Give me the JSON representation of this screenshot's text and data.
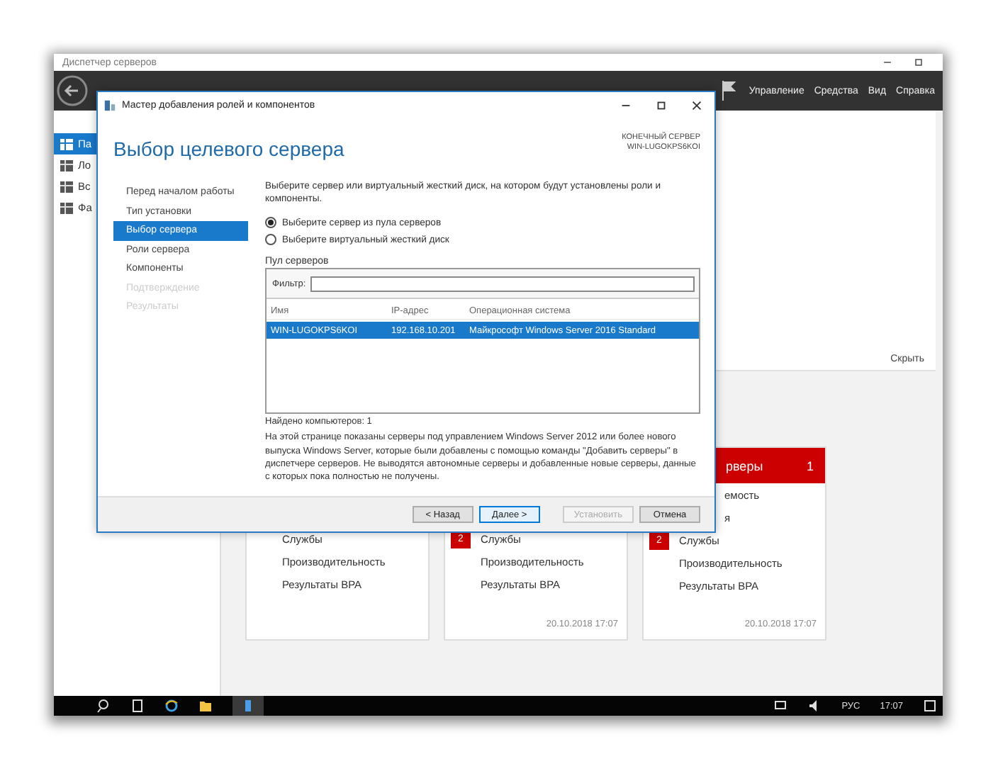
{
  "server_manager": {
    "title": "Диспетчер серверов",
    "menu": [
      "Управление",
      "Средства",
      "Вид",
      "Справка"
    ],
    "sidebar": [
      {
        "label": "Па",
        "selected": true
      },
      {
        "label": "Ло",
        "selected": false
      },
      {
        "label": "Вс",
        "selected": false
      },
      {
        "label": "Фа",
        "selected": false
      }
    ],
    "hide_link": "Скрыть",
    "tiles": [
      {
        "rows": [
          {
            "kind": "row",
            "badge": null,
            "label": "Службы"
          },
          {
            "kind": "row",
            "badge": null,
            "label": "Производительность"
          },
          {
            "kind": "row",
            "badge": null,
            "label": "Результаты BPA"
          }
        ]
      },
      {
        "rows": [
          {
            "kind": "row",
            "badge": "2",
            "label": "Службы"
          },
          {
            "kind": "row",
            "badge": null,
            "label": "Производительность"
          },
          {
            "kind": "row",
            "badge": null,
            "label": "Результаты BPA"
          }
        ],
        "timestamp": "20.10.2018 17:07"
      },
      {
        "header": {
          "title": "рверы",
          "count": "1"
        },
        "rows": [
          {
            "kind": "cut",
            "badge": null,
            "label": "емость"
          },
          {
            "kind": "cut",
            "badge": null,
            "label": "я"
          },
          {
            "kind": "row",
            "badge": "2",
            "label": "Службы"
          },
          {
            "kind": "row",
            "badge": null,
            "label": "Производительность"
          },
          {
            "kind": "row",
            "badge": null,
            "label": "Результаты BPA"
          }
        ],
        "timestamp": "20.10.2018 17:07"
      }
    ]
  },
  "wizard": {
    "title": "Мастер добавления ролей и компонентов",
    "heading": "Выбор целевого сервера",
    "destination_label": "КОНЕЧНЫЙ СЕРВЕР",
    "destination_server": "WIN-LUGOKPS6KOI",
    "steps": [
      {
        "label": "Перед началом работы",
        "selected": false,
        "disabled": false
      },
      {
        "label": "Тип установки",
        "selected": false,
        "disabled": false
      },
      {
        "label": "Выбор сервера",
        "selected": true,
        "disabled": false
      },
      {
        "label": "Роли сервера",
        "selected": false,
        "disabled": false
      },
      {
        "label": "Компоненты",
        "selected": false,
        "disabled": false
      },
      {
        "label": "Подтверждение",
        "selected": false,
        "disabled": true
      },
      {
        "label": "Результаты",
        "selected": false,
        "disabled": true
      }
    ],
    "intro": "Выберите сервер или виртуальный жесткий диск, на котором будут установлены роли и компоненты.",
    "options": [
      {
        "label": "Выберите сервер из пула серверов",
        "selected": true
      },
      {
        "label": "Выберите виртуальный жесткий диск",
        "selected": false
      }
    ],
    "pool_label": "Пул серверов",
    "filter_label": "Фильтр:",
    "columns": [
      "Имя",
      "IP-адрес",
      "Операционная система"
    ],
    "rows": [
      {
        "cells": [
          "WIN-LUGOKPS6KOI",
          "192.168.10.201",
          "Майкрософт Windows Server 2016 Standard"
        ],
        "selected": true
      }
    ],
    "found": "Найдено компьютеров: 1",
    "note": "На этой странице показаны серверы под управлением Windows Server 2012 или более нового выпуска Windows Server, которые были добавлены с помощью команды \"Добавить серверы\" в диспетчере серверов. Не выводятся автономные серверы и добавленные новые серверы, данные с которых пока полностью не получены.",
    "buttons": [
      {
        "label": "< Назад",
        "disabled": false,
        "focused": false
      },
      {
        "label": "Далее >",
        "disabled": false,
        "focused": true
      },
      {
        "label": "Установить",
        "disabled": true,
        "focused": false
      },
      {
        "label": "Отмена",
        "disabled": false,
        "focused": false
      }
    ]
  },
  "taskbar": {
    "language": "РУС",
    "time": "17:07"
  }
}
